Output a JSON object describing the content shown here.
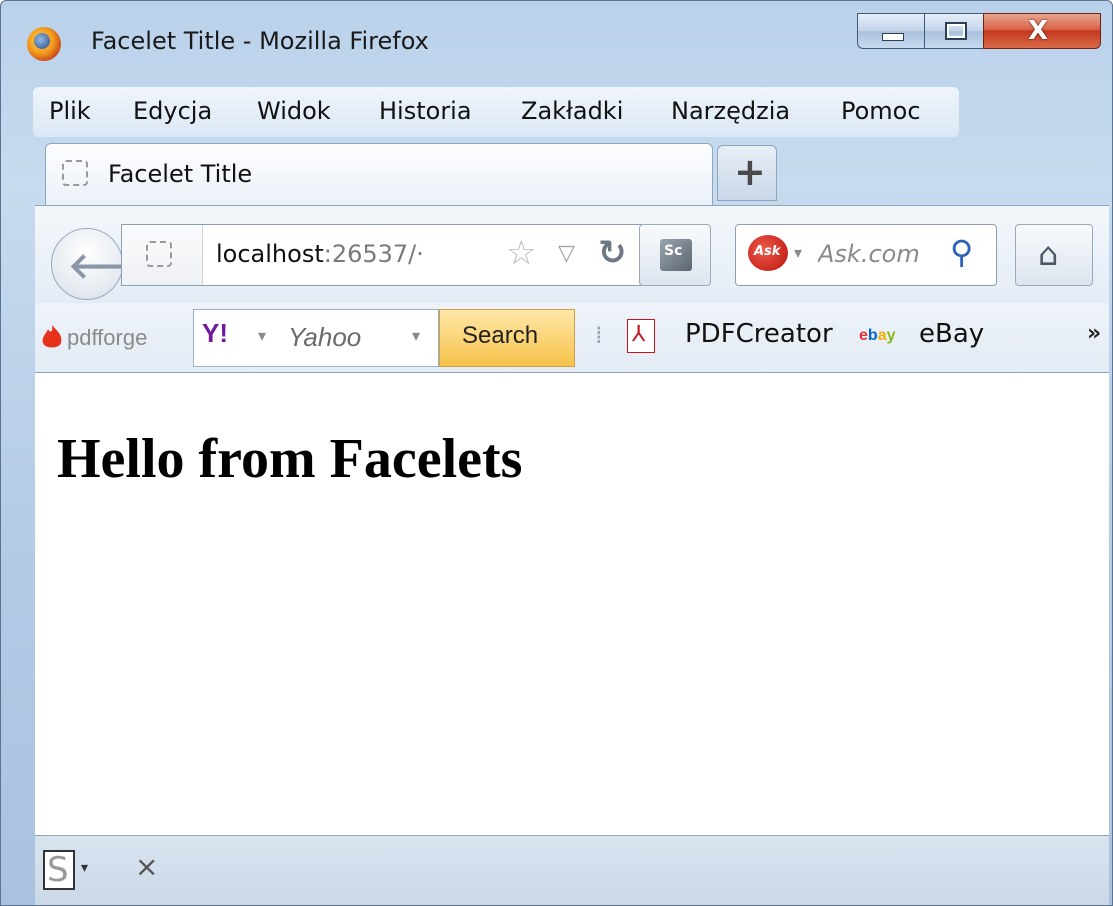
{
  "window": {
    "title": "Facelet Title - Mozilla Firefox",
    "close_glyph": "X"
  },
  "menubar": {
    "items": [
      {
        "label": "Plik"
      },
      {
        "label": "Edycja"
      },
      {
        "label": "Widok"
      },
      {
        "label": "Historia"
      },
      {
        "label": "Zakładki"
      },
      {
        "label": "Narzędzia"
      },
      {
        "label": "Pomoc"
      }
    ]
  },
  "tabs": {
    "active_title": "Facelet Title",
    "new_tab_glyph": "+"
  },
  "navbar": {
    "url_host": "localhost",
    "url_rest": ":26537/·",
    "search_placeholder": "Ask.com",
    "ask_logo_text": "Ask",
    "sc_text": "Sc"
  },
  "bookmarks": {
    "pdfforge": "pdfforge",
    "yahoo_logo": "Y!",
    "yahoo_placeholder": "Yahoo",
    "yahoo_search": "Search",
    "items": [
      {
        "label": "PDFCreator"
      },
      {
        "label": "eBay"
      }
    ],
    "overflow": "»"
  },
  "page": {
    "heading": "Hello from Facelets"
  },
  "statusbar": {
    "s_glyph": "S",
    "close_glyph": "×"
  },
  "colors": {
    "ebay_e": "#e53238",
    "ebay_b": "#0064d2",
    "ebay_a": "#f5af02",
    "ebay_y": "#86b817"
  }
}
